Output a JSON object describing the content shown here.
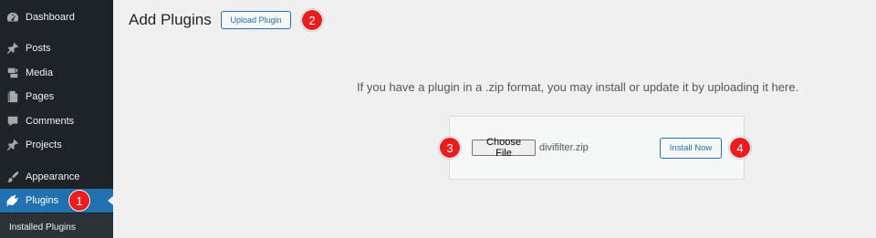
{
  "sidebar": {
    "items": [
      {
        "label": "Dashboard",
        "icon": "dashboard-icon"
      },
      {
        "label": "Posts",
        "icon": "pushpin-icon"
      },
      {
        "label": "Media",
        "icon": "media-icon"
      },
      {
        "label": "Pages",
        "icon": "pages-icon"
      },
      {
        "label": "Comments",
        "icon": "comment-icon"
      },
      {
        "label": "Projects",
        "icon": "pushpin-icon"
      },
      {
        "label": "Appearance",
        "icon": "paintbrush-icon"
      },
      {
        "label": "Plugins",
        "icon": "plugin-icon",
        "active": true
      }
    ],
    "submenu": {
      "installed_plugins": "Installed Plugins"
    }
  },
  "main": {
    "title": "Add Plugins",
    "upload_button": "Upload Plugin",
    "help_text": "If you have a plugin in a .zip format, you may install or update it by uploading it here.",
    "choose_file_label": "Choose File",
    "file_name": "divifilter.zip",
    "install_button": "Install Now"
  },
  "annotations": {
    "step1": "1",
    "step2": "2",
    "step3": "3",
    "step4": "4"
  },
  "colors": {
    "sidebar_bg": "#1d2327",
    "accent": "#2271b1",
    "badge": "#e81e1e",
    "page_bg": "#f0f0f1"
  }
}
